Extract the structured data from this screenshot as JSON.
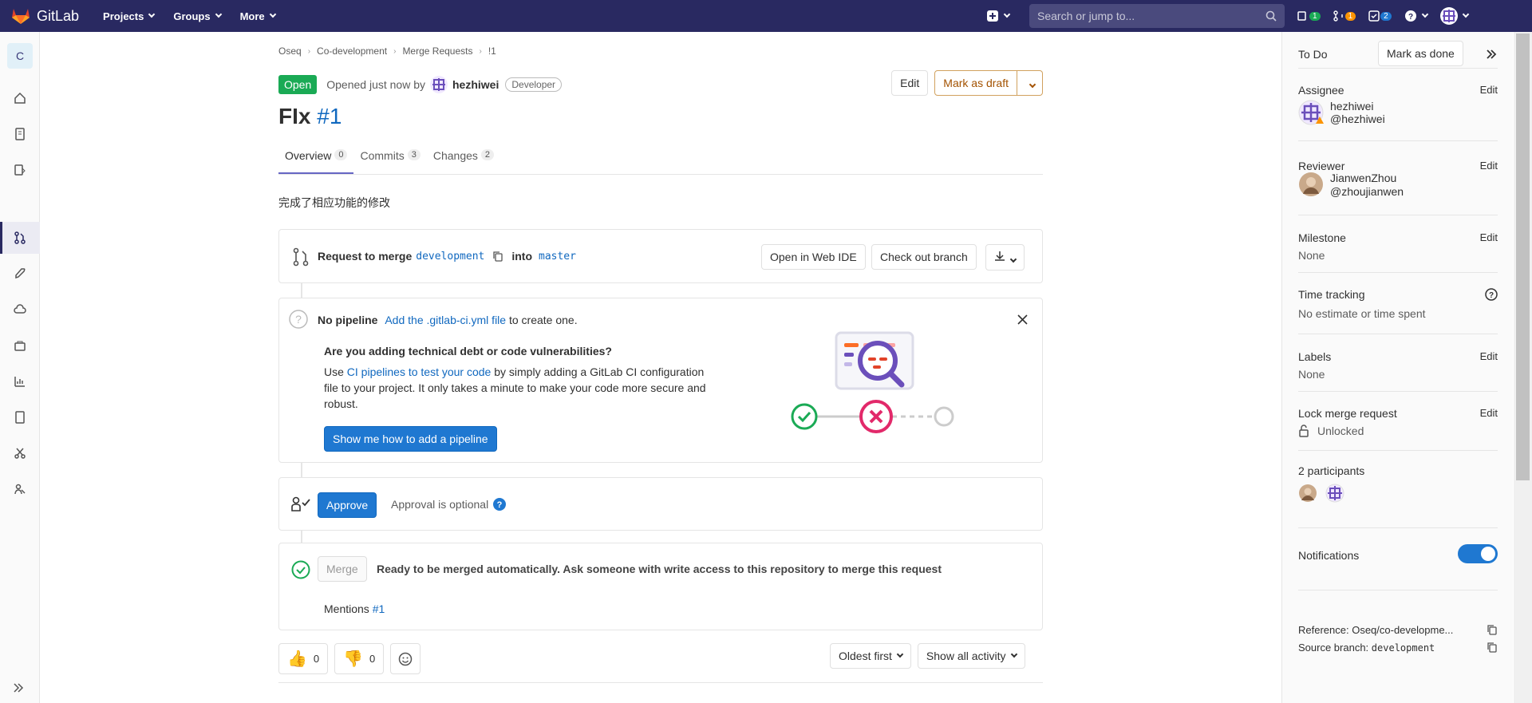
{
  "topbar": {
    "brand": "GitLab",
    "nav": [
      "Projects",
      "Groups",
      "More"
    ],
    "search_placeholder": "Search or jump to...",
    "issues_count": "1",
    "mr_count": "1",
    "todo_count": "2"
  },
  "leftbar": {
    "project_initial": "C"
  },
  "breadcrumb": [
    "Oseq",
    "Co-development",
    "Merge Requests",
    "!1"
  ],
  "mr": {
    "status": "Open",
    "opened_text": "Opened just now by",
    "author": "hezhiwei",
    "role": "Developer",
    "title": "FIx",
    "iid": "#1",
    "edit_label": "Edit",
    "draft_label": "Mark as draft",
    "tabs": [
      {
        "label": "Overview",
        "count": "0"
      },
      {
        "label": "Commits",
        "count": "3"
      },
      {
        "label": "Changes",
        "count": "2"
      }
    ],
    "description": "完成了相应功能的修改"
  },
  "merge_request_widget": {
    "request_text": "Request to merge",
    "source_branch": "development",
    "into": "into",
    "target_branch": "master",
    "web_ide_label": "Open in Web IDE",
    "checkout_label": "Check out branch"
  },
  "pipeline": {
    "title": "No pipeline",
    "link_text": "Add the .gitlab-ci.yml file",
    "suffix": "to create one.",
    "heading": "Are you adding technical debt or code vulnerabilities?",
    "body_pre": "Use",
    "body_link": "CI pipelines to test your code",
    "body_post_1": "by simply adding a GitLab CI configuration",
    "body_post_2": "file to your project. It only takes a minute to make your code more secure and",
    "body_post_3": "robust.",
    "cta": "Show me how to add a pipeline"
  },
  "approval": {
    "approve_label": "Approve",
    "optional_text": "Approval is optional"
  },
  "merge": {
    "merge_label": "Merge",
    "ready_text": "Ready to be merged automatically. Ask someone with write access to this repository to merge this request",
    "mentions_label": "Mentions",
    "mentions_link": "#1"
  },
  "activity": {
    "thumbs_up": "0",
    "thumbs_down": "0",
    "sort_label": "Oldest first",
    "filter_label": "Show all activity"
  },
  "sidebar": {
    "todo_label": "To Do",
    "mark_done_label": "Mark as done",
    "assignee_title": "Assignee",
    "assignee_name": "hezhiwei",
    "assignee_handle": "@hezhiwei",
    "reviewer_title": "Reviewer",
    "reviewer_name": "JianwenZhou",
    "reviewer_handle": "@zhoujianwen",
    "milestone_title": "Milestone",
    "milestone_value": "None",
    "time_title": "Time tracking",
    "time_value": "No estimate or time spent",
    "labels_title": "Labels",
    "labels_value": "None",
    "lock_title": "Lock merge request",
    "lock_value": "Unlocked",
    "participants_title": "2 participants",
    "notifications_title": "Notifications",
    "reference_text": "Reference: Oseq/co-developme...",
    "source_branch_label": "Source branch:",
    "source_branch_value": "development",
    "edit_label": "Edit"
  }
}
